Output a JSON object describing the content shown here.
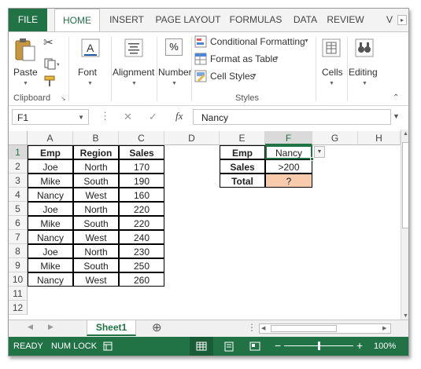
{
  "ribbon_tabs": [
    "FILE",
    "HOME",
    "INSERT",
    "PAGE LAYOUT",
    "FORMULAS",
    "DATA",
    "REVIEW",
    "V"
  ],
  "ribbon": {
    "clipboard": {
      "paste": "Paste",
      "group_label": "Clipboard"
    },
    "font": {
      "label": "Font"
    },
    "alignment": {
      "label": "Alignment"
    },
    "number": {
      "label": "Number",
      "icon_text": "%"
    },
    "styles": {
      "conditional_formatting": "Conditional Formatting",
      "format_as_table": "Format as Table",
      "cell_styles": "Cell Styles",
      "group_label": "Styles"
    },
    "cells": {
      "label": "Cells"
    },
    "editing": {
      "label": "Editing"
    }
  },
  "formula_bar": {
    "name_box": "F1",
    "cancel": "✕",
    "enter": "✓",
    "fx": "fx",
    "value": "Nancy"
  },
  "grid": {
    "columns": [
      "A",
      "B",
      "C",
      "D",
      "E",
      "F",
      "G",
      "H"
    ],
    "rows": [
      "1",
      "2",
      "3",
      "4",
      "5",
      "6",
      "7",
      "8",
      "9",
      "10",
      "11",
      "12"
    ],
    "selected_column": "F",
    "selected_row": "1",
    "table": {
      "headers": [
        "Emp",
        "Region",
        "Sales"
      ],
      "rows": [
        [
          "Joe",
          "North",
          "170"
        ],
        [
          "Mike",
          "South",
          "190"
        ],
        [
          "Nancy",
          "West",
          "160"
        ],
        [
          "Joe",
          "North",
          "220"
        ],
        [
          "Mike",
          "South",
          "220"
        ],
        [
          "Nancy",
          "West",
          "240"
        ],
        [
          "Joe",
          "North",
          "230"
        ],
        [
          "Mike",
          "South",
          "250"
        ],
        [
          "Nancy",
          "West",
          "260"
        ]
      ]
    },
    "criteria": {
      "labels": [
        "Emp",
        "Sales",
        "Total"
      ],
      "values": [
        "Nancy",
        ">200",
        "?"
      ]
    }
  },
  "sheet_tabs": {
    "active": "Sheet1",
    "add": "⊕"
  },
  "status_bar": {
    "ready": "READY",
    "num_lock": "NUM LOCK",
    "zoom": "100%",
    "zoom_value": 1.0
  },
  "colors": {
    "accent": "#217346",
    "total_fill": "#f8cbad",
    "selected_header": "#dadada"
  }
}
